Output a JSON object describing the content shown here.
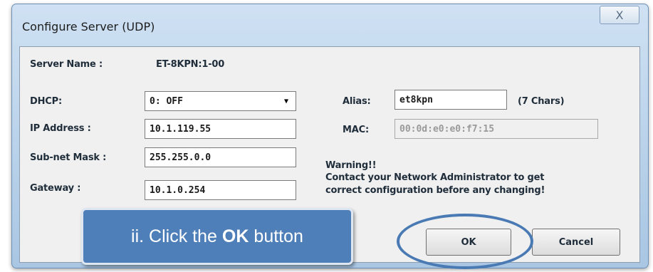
{
  "dialog": {
    "title": "Configure Server (UDP)",
    "close_symbol": "X"
  },
  "server_name": {
    "label": "Server Name :",
    "value": "ET-8KPN:1-00"
  },
  "dhcp": {
    "label": "DHCP:",
    "value": "0: OFF"
  },
  "ip_address": {
    "label": "IP Address :",
    "value": "10.1.119.55"
  },
  "subnet_mask": {
    "label": "Sub-net Mask :",
    "value": "255.255.0.0"
  },
  "gateway": {
    "label": "Gateway :",
    "value": "10.1.0.254"
  },
  "alias": {
    "label": "Alias:",
    "value": "et8kpn",
    "hint": "(7 Chars)"
  },
  "mac": {
    "label": "MAC:",
    "value": "00:0d:e0:e0:f7:15"
  },
  "warning": {
    "title": "Warning!!",
    "line1": "Contact your Network Administrator to get",
    "line2": "correct  configuration before any changing!"
  },
  "buttons": {
    "ok": "OK",
    "cancel": "Cancel"
  },
  "callout": {
    "prefix": "ii. Click the",
    "bold": "OK",
    "suffix": "button"
  },
  "colors": {
    "callout_bg": "#4f7fb8",
    "highlight": "#4a7ab3"
  },
  "icons": {
    "dropdown": "chevron-down-icon",
    "close": "close-icon"
  }
}
